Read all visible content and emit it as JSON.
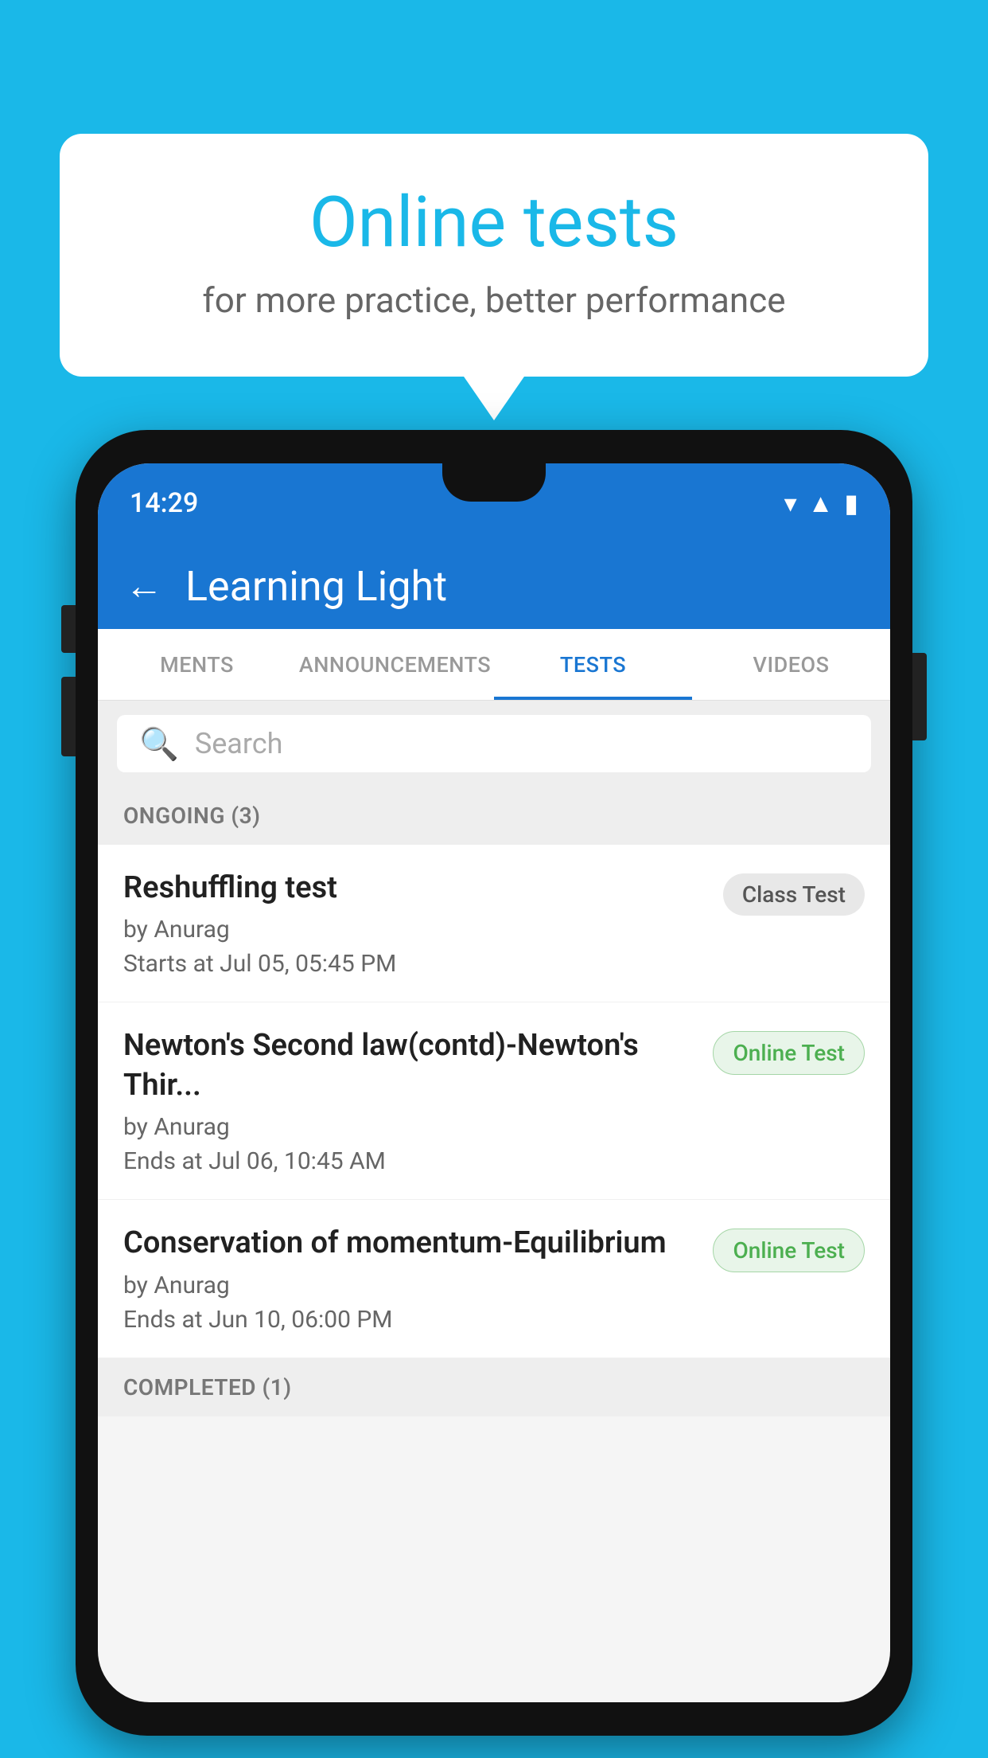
{
  "background_color": "#1ab8e8",
  "speech_bubble": {
    "title": "Online tests",
    "subtitle": "for more practice, better performance"
  },
  "phone": {
    "status_bar": {
      "time": "14:29",
      "icons": [
        "wifi",
        "signal",
        "battery"
      ]
    },
    "app_bar": {
      "title": "Learning Light",
      "back_label": "←"
    },
    "tabs": [
      {
        "label": "MENTS",
        "active": false
      },
      {
        "label": "ANNOUNCEMENTS",
        "active": false
      },
      {
        "label": "TESTS",
        "active": true
      },
      {
        "label": "VIDEOS",
        "active": false
      }
    ],
    "search": {
      "placeholder": "Search"
    },
    "ongoing_section": {
      "header": "ONGOING (3)",
      "tests": [
        {
          "title": "Reshuffling test",
          "author": "by Anurag",
          "time_label": "Starts at",
          "time": "Jul 05, 05:45 PM",
          "badge": "Class Test",
          "badge_type": "class"
        },
        {
          "title": "Newton's Second law(contd)-Newton's Thir...",
          "author": "by Anurag",
          "time_label": "Ends at",
          "time": "Jul 06, 10:45 AM",
          "badge": "Online Test",
          "badge_type": "online"
        },
        {
          "title": "Conservation of momentum-Equilibrium",
          "author": "by Anurag",
          "time_label": "Ends at",
          "time": "Jun 10, 06:00 PM",
          "badge": "Online Test",
          "badge_type": "online"
        }
      ]
    },
    "completed_section": {
      "header": "COMPLETED (1)"
    }
  }
}
